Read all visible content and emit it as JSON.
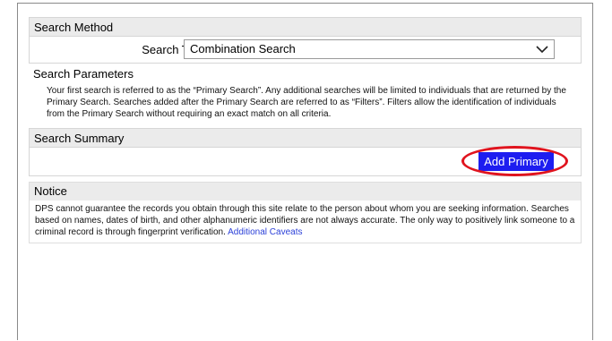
{
  "search_method": {
    "header": "Search Method",
    "search_type_label": "Search Type",
    "search_type_value": "Combination Search"
  },
  "search_parameters": {
    "header": "Search Parameters",
    "description": "Your first search is referred to as the “Primary Search”. Any additional searches will be limited to individuals that are returned by the Primary Search.  Searches added after the Primary Search are referred to as “Filters”.  Filters allow the identification of individuals from the Primary Search without requiring an exact match on all criteria."
  },
  "search_summary": {
    "header": "Search Summary",
    "add_primary_label": "Add Primary"
  },
  "notice": {
    "header": "Notice",
    "text": "DPS cannot guarantee the records you obtain through this site relate to the person about whom you are seeking information.  Searches based on names, dates of birth, and other alphanumeric identifiers are not always accurate.  The only way to positively link someone to a criminal record is through fingerprint verification.",
    "link_label": "Additional Caveats"
  },
  "colors": {
    "button_bg": "#1d1df0",
    "highlight": "#e0141e",
    "link": "#2a3fd8"
  }
}
